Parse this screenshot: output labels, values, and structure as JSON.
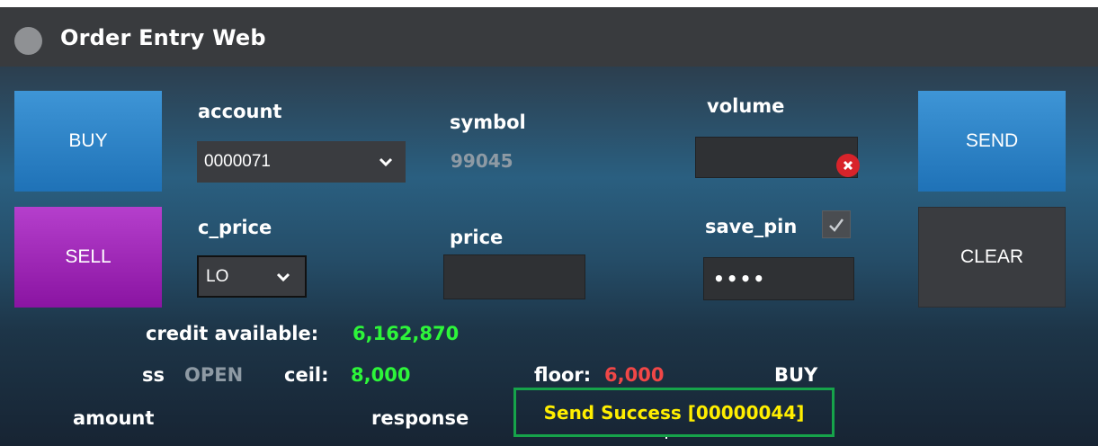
{
  "window": {
    "title": "Order Entry Web"
  },
  "buttons": {
    "buy": "BUY",
    "sell": "SELL",
    "send": "SEND",
    "clear": "CLEAR"
  },
  "labels": {
    "account": "account",
    "symbol": "symbol",
    "volume": "volume",
    "c_price": "c_price",
    "price": "price",
    "save_pin": "save_pin",
    "credit_available": "credit available:",
    "ss": "ss",
    "ceil": "ceil:",
    "floor": "floor:",
    "amount": "amount",
    "response": "response"
  },
  "fields": {
    "account_value": "0000071",
    "symbol_value": "99045",
    "volume_value": "",
    "c_price_value": "LO",
    "price_value": "",
    "pin_value": "••••",
    "save_pin_checked": true
  },
  "info": {
    "credit_available": "6,162,870",
    "ss_value": "OPEN",
    "ceil_value": "8,000",
    "floor_value": "6,000",
    "side": "BUY"
  },
  "response": {
    "text": "Send Success [00000044]"
  },
  "colors": {
    "buy": "#2a83c8",
    "sell": "#a02ab8",
    "credit_green": "#2df53a",
    "floor_red": "#f04747",
    "response_yellow": "#ffee00",
    "highlight_border": "#16a34a"
  },
  "icons": {
    "window": "circle-icon",
    "account_dropdown": "chevron-down-icon",
    "cprice_dropdown": "chevron-down-icon",
    "volume_clear": "close-circle-icon",
    "save_pin_check": "checkmark-icon"
  }
}
